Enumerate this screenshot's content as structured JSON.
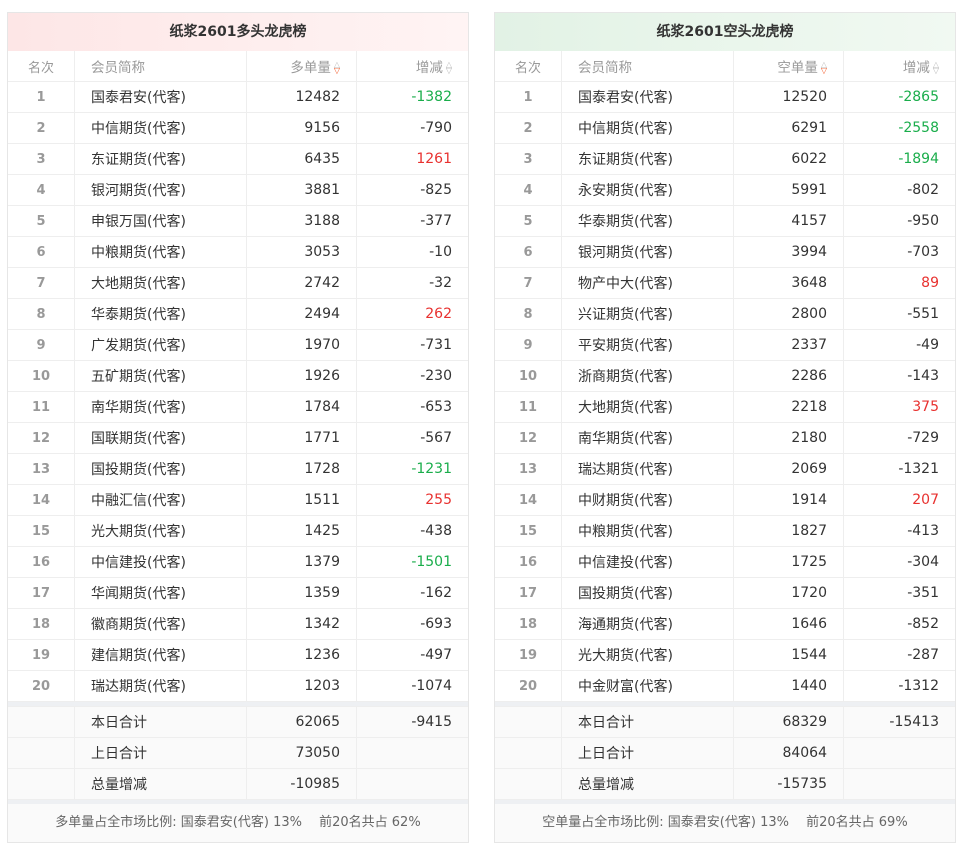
{
  "panels": [
    {
      "title": "纸浆2601多头龙虎榜",
      "cols": [
        "名次",
        "会员简称",
        "多单量",
        "增减"
      ],
      "rows": [
        [
          "1",
          "国泰君安(代客)",
          "12482",
          "-1382",
          "down"
        ],
        [
          "2",
          "中信期货(代客)",
          "9156",
          "-790",
          ""
        ],
        [
          "3",
          "东证期货(代客)",
          "6435",
          "1261",
          "up"
        ],
        [
          "4",
          "银河期货(代客)",
          "3881",
          "-825",
          ""
        ],
        [
          "5",
          "申银万国(代客)",
          "3188",
          "-377",
          ""
        ],
        [
          "6",
          "中粮期货(代客)",
          "3053",
          "-10",
          ""
        ],
        [
          "7",
          "大地期货(代客)",
          "2742",
          "-32",
          ""
        ],
        [
          "8",
          "华泰期货(代客)",
          "2494",
          "262",
          "up"
        ],
        [
          "9",
          "广发期货(代客)",
          "1970",
          "-731",
          ""
        ],
        [
          "10",
          "五矿期货(代客)",
          "1926",
          "-230",
          ""
        ],
        [
          "11",
          "南华期货(代客)",
          "1784",
          "-653",
          ""
        ],
        [
          "12",
          "国联期货(代客)",
          "1771",
          "-567",
          ""
        ],
        [
          "13",
          "国投期货(代客)",
          "1728",
          "-1231",
          "down"
        ],
        [
          "14",
          "中融汇信(代客)",
          "1511",
          "255",
          "up"
        ],
        [
          "15",
          "光大期货(代客)",
          "1425",
          "-438",
          ""
        ],
        [
          "16",
          "中信建投(代客)",
          "1379",
          "-1501",
          "down"
        ],
        [
          "17",
          "华闻期货(代客)",
          "1359",
          "-162",
          ""
        ],
        [
          "18",
          "徽商期货(代客)",
          "1342",
          "-693",
          ""
        ],
        [
          "19",
          "建信期货(代客)",
          "1236",
          "-497",
          ""
        ],
        [
          "20",
          "瑞达期货(代客)",
          "1203",
          "-1074",
          ""
        ]
      ],
      "summary": [
        [
          "本日合计",
          "62065",
          "-9415"
        ],
        [
          "上日合计",
          "73050",
          ""
        ],
        [
          "总量增减",
          "-10985",
          ""
        ]
      ],
      "footer": "多单量占全市场比例: 国泰君安(代客) 13%　 前20名共占 62%"
    },
    {
      "title": "纸浆2601空头龙虎榜",
      "cols": [
        "名次",
        "会员简称",
        "空单量",
        "增减"
      ],
      "rows": [
        [
          "1",
          "国泰君安(代客)",
          "12520",
          "-2865",
          "down"
        ],
        [
          "2",
          "中信期货(代客)",
          "6291",
          "-2558",
          "down"
        ],
        [
          "3",
          "东证期货(代客)",
          "6022",
          "-1894",
          "down"
        ],
        [
          "4",
          "永安期货(代客)",
          "5991",
          "-802",
          ""
        ],
        [
          "5",
          "华泰期货(代客)",
          "4157",
          "-950",
          ""
        ],
        [
          "6",
          "银河期货(代客)",
          "3994",
          "-703",
          ""
        ],
        [
          "7",
          "物产中大(代客)",
          "3648",
          "89",
          "up"
        ],
        [
          "8",
          "兴证期货(代客)",
          "2800",
          "-551",
          ""
        ],
        [
          "9",
          "平安期货(代客)",
          "2337",
          "-49",
          ""
        ],
        [
          "10",
          "浙商期货(代客)",
          "2286",
          "-143",
          ""
        ],
        [
          "11",
          "大地期货(代客)",
          "2218",
          "375",
          "up"
        ],
        [
          "12",
          "南华期货(代客)",
          "2180",
          "-729",
          ""
        ],
        [
          "13",
          "瑞达期货(代客)",
          "2069",
          "-1321",
          ""
        ],
        [
          "14",
          "中财期货(代客)",
          "1914",
          "207",
          "up"
        ],
        [
          "15",
          "中粮期货(代客)",
          "1827",
          "-413",
          ""
        ],
        [
          "16",
          "中信建投(代客)",
          "1725",
          "-304",
          ""
        ],
        [
          "17",
          "国投期货(代客)",
          "1720",
          "-351",
          ""
        ],
        [
          "18",
          "海通期货(代客)",
          "1646",
          "-852",
          ""
        ],
        [
          "19",
          "光大期货(代客)",
          "1544",
          "-287",
          ""
        ],
        [
          "20",
          "中金财富(代客)",
          "1440",
          "-1312",
          ""
        ]
      ],
      "summary": [
        [
          "本日合计",
          "68329",
          "-15413"
        ],
        [
          "上日合计",
          "84064",
          ""
        ],
        [
          "总量增减",
          "-15735",
          ""
        ]
      ],
      "footer": "空单量占全市场比例: 国泰君安(代客) 13%　 前20名共占 69%"
    }
  ],
  "colors": {
    "up": "#e8312f",
    "down": "#1aad4b"
  }
}
